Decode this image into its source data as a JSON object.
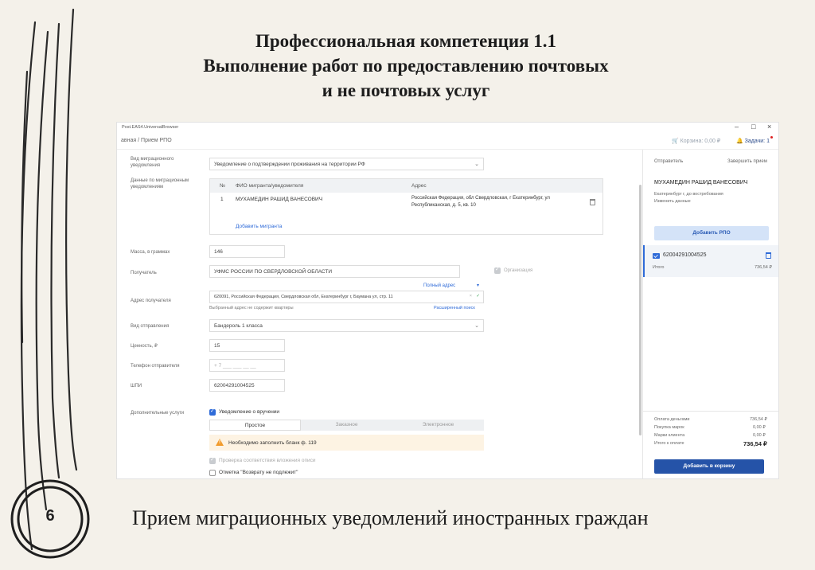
{
  "slide": {
    "title_line1": "Профессиональная компетенция 1.1",
    "title_line2": "Выполнение работ по предоставлению почтовых",
    "title_line3": "и не почтовых услуг",
    "page_number": "6",
    "caption": "Прием миграционных уведомлений иностранных граждан"
  },
  "app": {
    "window_title": "Post.EAS4.UniversalBrowser",
    "window_controls": {
      "minimize": "–",
      "maximize": "□",
      "close": "×"
    },
    "breadcrumb": {
      "parent": "авная",
      "separator": "/",
      "current": "Прием РПО"
    },
    "cart_label": "Корзина: 0,00 ₽",
    "tasks_label": "Задачи: 1"
  },
  "form": {
    "migration_type_label": "Вид миграционного уведомления",
    "migration_type_value": "Уведомление о подтверждении проживания на территории РФ",
    "migration_data_label": "Данные по миграционным уведомлениям",
    "table": {
      "headers": [
        "№",
        "ФИО мигранта/уведомителя",
        "Адрес"
      ],
      "rows": [
        {
          "num": "1",
          "name": "МУХАМЕДИН РАШИД ВАНЕСОВИЧ",
          "address_line1": "Российская Федерация, обл Свердловская, г Екатеринбург, ул",
          "address_line2": "Республиканская, д. 5, кв. 10"
        }
      ],
      "add_link": "Добавить мигранта"
    },
    "mass_label": "Масса, в граммах",
    "mass_value": "146",
    "recipient_label": "Получатель",
    "recipient_value": "УФМС РОССИИ ПО СВЕРДЛОВСКОЙ ОБЛАСТИ",
    "organization_label": "Организация",
    "full_address_link": "Полный адрес",
    "address_label": "Адрес получателя",
    "address_value": "620091, Российская Федерация, Свердловская обл, Екатеринбург г, Баумана ул, стр. 11",
    "address_hint": "Выбранный адрес не содержит квартиры",
    "advanced_search_link": "Расширенный поиск",
    "shipment_type_label": "Вид отправления",
    "shipment_type_value": "Бандероль 1 класса",
    "value_label": "Ценность, ₽",
    "value_value": "15",
    "phone_label": "Телефон отправителя",
    "phone_placeholder": "+ 7 ___ ___ __ __",
    "barcode_label": "ШПИ",
    "barcode_value": "62004291004525",
    "extra_services_label": "Дополнительные услуги",
    "delivery_notice_label": "Уведомление о вручении",
    "notice_tabs": [
      "Простое",
      "Заказное",
      "Электронное"
    ],
    "warning_text": "Необходимо заполнить бланк ф. 119",
    "check_inventory_label": "Проверка соответствия вложения описи",
    "no_return_label": "Отметка \"Возврату не подлежит\""
  },
  "sidebar": {
    "sender_label": "Отправитель",
    "finish_link": "Завершить прием",
    "sender_name": "МУХАМЕДИН РАШИД ВАНЕСОВИЧ",
    "sender_city": "Екатеринбург г, до востребования",
    "change_link": "Изменить данные",
    "add_rpo_button": "Добавить РПО",
    "rpo_number": "62004291004525",
    "rpo_total_label": "Итого",
    "rpo_total_value": "736,54 ₽",
    "summary": [
      {
        "label": "Оплата деньгами",
        "value": "736,54 ₽"
      },
      {
        "label": "Покупка марок",
        "value": "0,00 ₽"
      },
      {
        "label": "Марки клиента",
        "value": "0,00 ₽"
      }
    ],
    "total_label": "Итого к оплате",
    "total_value": "736,54 ₽",
    "add_to_cart_button": "Добавить в корзину"
  },
  "colors": {
    "accent": "#2f6bd8",
    "button_dark": "#2553a8",
    "button_light": "#d4e3f8",
    "warning_bg": "#fdf3e3",
    "warning_icon": "#f19b2c"
  }
}
